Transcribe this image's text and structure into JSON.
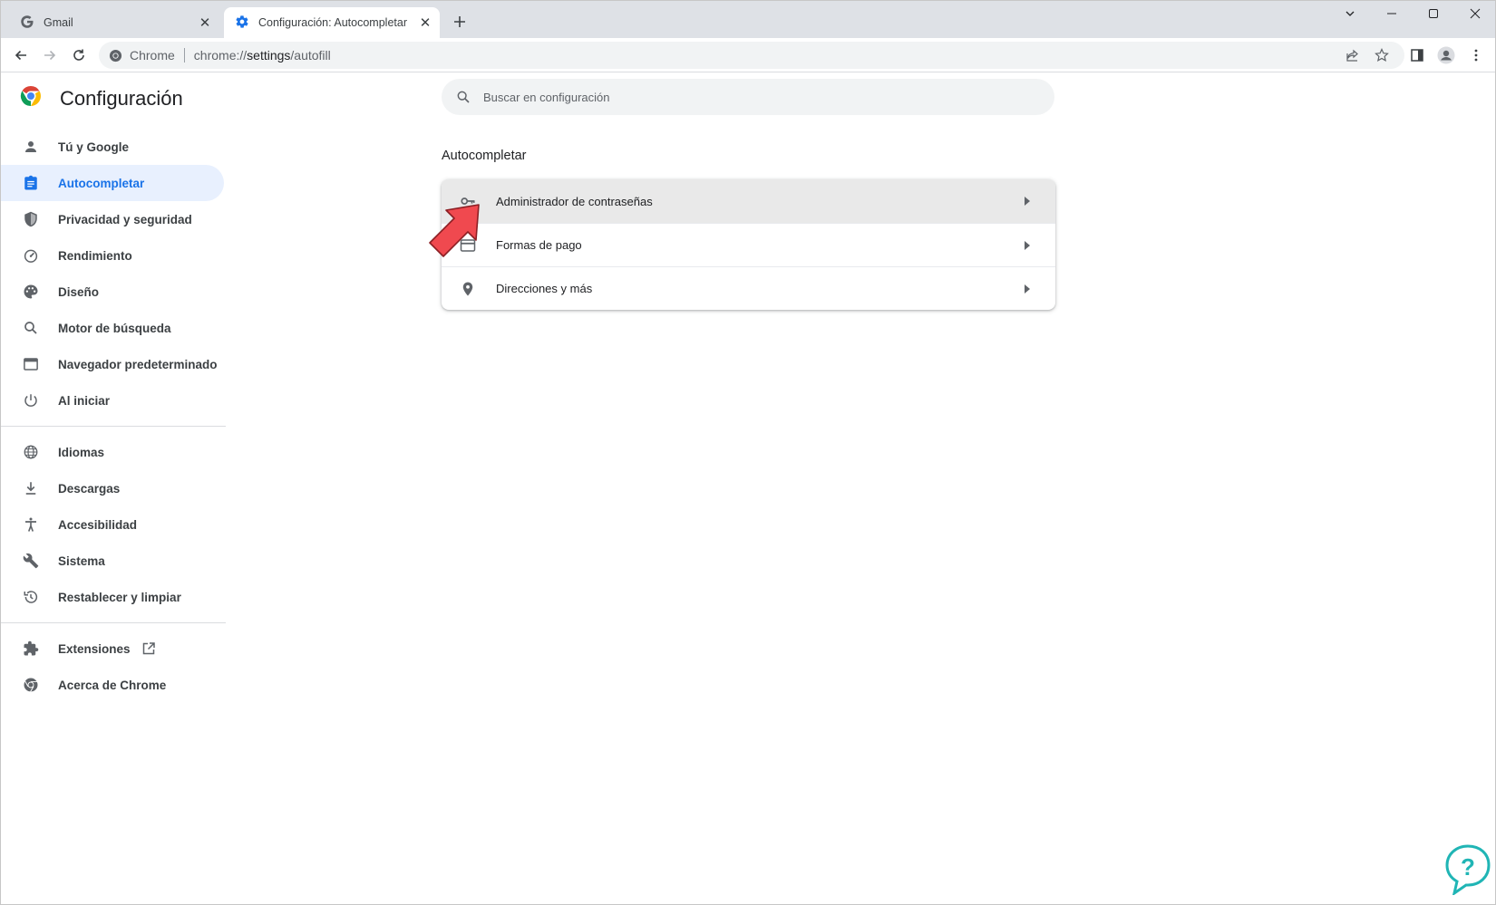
{
  "tabs": [
    {
      "title": "Gmail",
      "icon": "google-g-icon"
    },
    {
      "title": "Configuración: Autocompletar",
      "icon": "settings-gear-icon"
    }
  ],
  "toolbar": {
    "site_chip": "Chrome",
    "url_scheme": "chrome://",
    "url_host": "settings",
    "url_path": "/autofill"
  },
  "sidebar": {
    "app_title": "Configuración",
    "items": [
      {
        "label": "Tú y Google",
        "icon": "person-icon"
      },
      {
        "label": "Autocompletar",
        "icon": "clipboard-icon",
        "active": true
      },
      {
        "label": "Privacidad y seguridad",
        "icon": "shield-icon"
      },
      {
        "label": "Rendimiento",
        "icon": "speedometer-icon"
      },
      {
        "label": "Diseño",
        "icon": "palette-icon"
      },
      {
        "label": "Motor de búsqueda",
        "icon": "search-icon"
      },
      {
        "label": "Navegador predeterminado",
        "icon": "browser-window-icon"
      },
      {
        "label": "Al iniciar",
        "icon": "power-icon"
      },
      {
        "label": "Idiomas",
        "icon": "globe-icon"
      },
      {
        "label": "Descargas",
        "icon": "download-icon"
      },
      {
        "label": "Accesibilidad",
        "icon": "accessibility-icon"
      },
      {
        "label": "Sistema",
        "icon": "wrench-icon"
      },
      {
        "label": "Restablecer y limpiar",
        "icon": "restore-icon"
      },
      {
        "label": "Extensiones",
        "icon": "puzzle-icon"
      },
      {
        "label": "Acerca de Chrome",
        "icon": "chrome-icon"
      }
    ]
  },
  "main": {
    "search_placeholder": "Buscar en configuración",
    "section_title": "Autocompletar",
    "rows": [
      {
        "label": "Administrador de contraseñas",
        "icon": "key-icon"
      },
      {
        "label": "Formas de pago",
        "icon": "credit-card-icon"
      },
      {
        "label": "Direcciones y más",
        "icon": "location-pin-icon"
      }
    ]
  },
  "colors": {
    "accent": "#1a73e8",
    "active_nav_bg": "#e8f0fe",
    "tabstrip_bg": "#dee1e6",
    "pointer_arrow": "#f0494f",
    "watermark": "#20b5b5"
  }
}
